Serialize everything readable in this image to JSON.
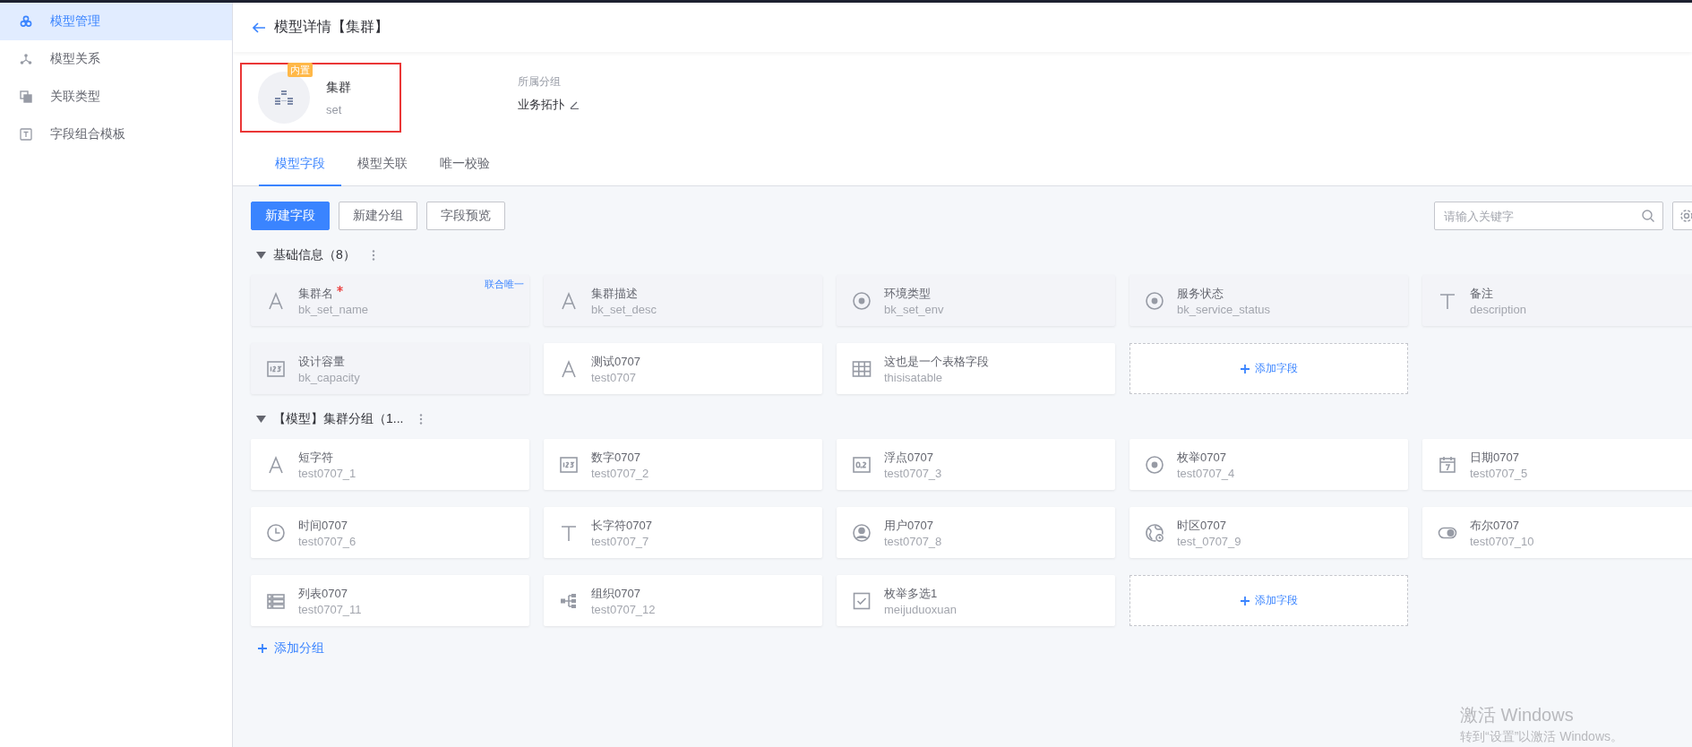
{
  "sidebar": {
    "items": [
      {
        "label": "模型管理",
        "selected": true
      },
      {
        "label": "模型关系",
        "selected": false
      },
      {
        "label": "关联类型",
        "selected": false
      },
      {
        "label": "字段组合模板",
        "selected": false
      }
    ]
  },
  "header": {
    "title": "模型详情【集群】"
  },
  "model": {
    "badge": "内置",
    "name": "集群",
    "id": "set",
    "group_label": "所属分组",
    "group_value": "业务拓扑"
  },
  "tabs": [
    {
      "label": "模型字段",
      "selected": true
    },
    {
      "label": "模型关联",
      "selected": false
    },
    {
      "label": "唯一校验",
      "selected": false
    }
  ],
  "toolbar": {
    "buttons": [
      {
        "label": "新建字段",
        "kind": "primary"
      },
      {
        "label": "新建分组",
        "kind": "default"
      },
      {
        "label": "字段预览",
        "kind": "default"
      }
    ],
    "search": {
      "placeholder": "请输入关键字"
    }
  },
  "groups": [
    {
      "title": "基础信息（8）",
      "expanded": true,
      "add_label": "添加字段",
      "fields": [
        {
          "kind": "text",
          "name": "集群名",
          "id": "bk_set_name",
          "required": true,
          "preset": true,
          "tag": "联合唯一"
        },
        {
          "kind": "text",
          "name": "集群描述",
          "id": "bk_set_desc",
          "required": false,
          "preset": true
        },
        {
          "kind": "enum",
          "name": "环境类型",
          "id": "bk_set_env",
          "required": false,
          "preset": true
        },
        {
          "kind": "enum",
          "name": "服务状态",
          "id": "bk_service_status",
          "required": false,
          "preset": true
        },
        {
          "kind": "longtext",
          "name": "备注",
          "id": "description",
          "required": false,
          "preset": true
        },
        {
          "kind": "int",
          "name": "设计容量",
          "id": "bk_capacity",
          "required": false,
          "preset": true
        },
        {
          "kind": "text",
          "name": "测试0707",
          "id": "test0707",
          "required": false,
          "preset": false
        },
        {
          "kind": "table",
          "name": "这也是一个表格字段",
          "id": "thisisatable",
          "required": false,
          "preset": false
        }
      ]
    },
    {
      "title": "【模型】集群分组（1...",
      "expanded": true,
      "add_label": "添加字段",
      "fields": [
        {
          "kind": "text",
          "name": "短字符",
          "id": "test0707_1",
          "required": false,
          "preset": false
        },
        {
          "kind": "int",
          "name": "数字0707",
          "id": "test0707_2",
          "required": false,
          "preset": false
        },
        {
          "kind": "float",
          "name": "浮点0707",
          "id": "test0707_3",
          "required": false,
          "preset": false
        },
        {
          "kind": "enum",
          "name": "枚举0707",
          "id": "test0707_4",
          "required": false,
          "preset": false
        },
        {
          "kind": "date",
          "name": "日期0707",
          "id": "test0707_5",
          "required": false,
          "preset": false
        },
        {
          "kind": "time",
          "name": "时间0707",
          "id": "test0707_6",
          "required": false,
          "preset": false
        },
        {
          "kind": "longtext",
          "name": "长字符0707",
          "id": "test0707_7",
          "required": false,
          "preset": false
        },
        {
          "kind": "user",
          "name": "用户0707",
          "id": "test0707_8",
          "required": false,
          "preset": false
        },
        {
          "kind": "timezone",
          "name": "时区0707",
          "id": "test_0707_9",
          "required": false,
          "preset": false
        },
        {
          "kind": "bool",
          "name": "布尔0707",
          "id": "test0707_10",
          "required": false,
          "preset": false
        },
        {
          "kind": "list",
          "name": "列表0707",
          "id": "test0707_11",
          "required": false,
          "preset": false
        },
        {
          "kind": "org",
          "name": "组织0707",
          "id": "test0707_12",
          "required": false,
          "preset": false
        },
        {
          "kind": "enummulti",
          "name": "枚举多选1",
          "id": "meijuduoxuan",
          "required": false,
          "preset": false
        }
      ]
    }
  ],
  "add_group": "添加分组",
  "os_notice": {
    "title": "激活 Windows",
    "text": "转到“设置”以激活 Windows。"
  }
}
